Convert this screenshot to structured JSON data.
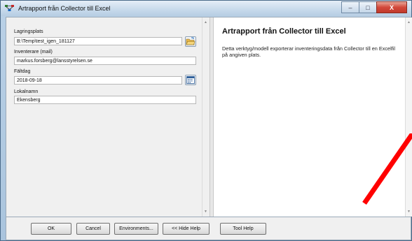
{
  "window": {
    "title": "Artrapport från Collector till Excel",
    "controls": {
      "minimize": "–",
      "maximize": "□",
      "close": "X"
    }
  },
  "form": {
    "fields": [
      {
        "label": "Lagringsplats",
        "value": "B:\\Temp\\test_igen_181127",
        "button_icon": "folder-open-icon"
      },
      {
        "label": "Inventerare (mail)",
        "value": "markus.forsberg@lansstyrelsen.se"
      },
      {
        "label": "Fältdag",
        "value": "2018-09-18",
        "button_icon": "calendar-icon"
      },
      {
        "label": "Lokalnamn",
        "value": "Ekensberg"
      }
    ]
  },
  "help": {
    "title": "Artrapport från Collector till Excel",
    "body": "Detta verktyg/modell exporterar inventeringsdata från Collector till en Excelfil på angiven plats."
  },
  "buttons": {
    "ok": "OK",
    "cancel": "Cancel",
    "environments": "Environments...",
    "hide_help": "<< Hide Help",
    "tool_help": "Tool Help"
  },
  "colors": {
    "annotation": "#ff0000"
  }
}
